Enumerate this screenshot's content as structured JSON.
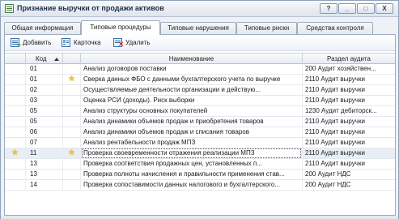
{
  "window": {
    "title": "Признание выручки от продажи активов",
    "buttons": {
      "help": "?",
      "minimize": "_",
      "maximize": "□",
      "close": "X"
    }
  },
  "tabs": [
    {
      "label": "Общая информация"
    },
    {
      "label": "Типовые процедуры",
      "active": true
    },
    {
      "label": "Типовые нарушения"
    },
    {
      "label": "Типовые риски"
    },
    {
      "label": "Средства контроля"
    }
  ],
  "toolbar": {
    "add_label": "Добавить",
    "card_label": "Карточка",
    "delete_label": "Удалить"
  },
  "table": {
    "columns": {
      "code": "Код",
      "name": "Наименование",
      "section": "Раздел аудита"
    },
    "rows": [
      {
        "code": "01",
        "fav": false,
        "name": "Анализ договоров поставки",
        "section": "200 Аудит хозяйствен..."
      },
      {
        "code": "01",
        "fav": true,
        "name": "Сверка данных ФБО с данными бухгалтерского учета по выручке",
        "section": "2110 Аудит выручки"
      },
      {
        "code": "02",
        "fav": false,
        "name": "Осуществляемые деятельности организации и действую...",
        "section": "2110 Аудит выручки"
      },
      {
        "code": "03",
        "fav": false,
        "name": "Оценка РСИ (доходы). Риск выборки",
        "section": "2110 Аудит выручки"
      },
      {
        "code": "05",
        "fav": false,
        "name": "Анализ структуры основных покупателей",
        "section": "1230 Аудит дебиторск..."
      },
      {
        "code": "05",
        "fav": false,
        "name": "Анализ динамики объемов продаж и приобретения товаров",
        "section": "2110 Аудит выручки"
      },
      {
        "code": "06",
        "fav": false,
        "name": "Анализ динамики объемов продаж и списания товаров",
        "section": "2110 Аудит выручки"
      },
      {
        "code": "07",
        "fav": false,
        "name": "Анализ рентабельности продаж МПЗ",
        "section": "2110 Аудит выручки"
      },
      {
        "code": "11",
        "fav": true,
        "selected": true,
        "name": "Проверка своевременности отражения реализации МПЗ",
        "section": "2110 Аудит выручки"
      },
      {
        "code": "13",
        "fav": false,
        "name": "Проверка соответствия продажных цен, установленных п...",
        "section": "2110 Аудит выручки"
      },
      {
        "code": "13",
        "fav": false,
        "name": "Проверка полноты начисления и правильности применения став...",
        "section": "200 Аудит НДС"
      },
      {
        "code": "14",
        "fav": false,
        "name": "Проверка сопоставимости данных налогового и бухгалтерского...",
        "section": "200 Аудит НДС"
      }
    ]
  },
  "colors": {
    "accent": "#3a6fa8",
    "star": "#f4c531",
    "selected_row": "#e8eef6"
  }
}
